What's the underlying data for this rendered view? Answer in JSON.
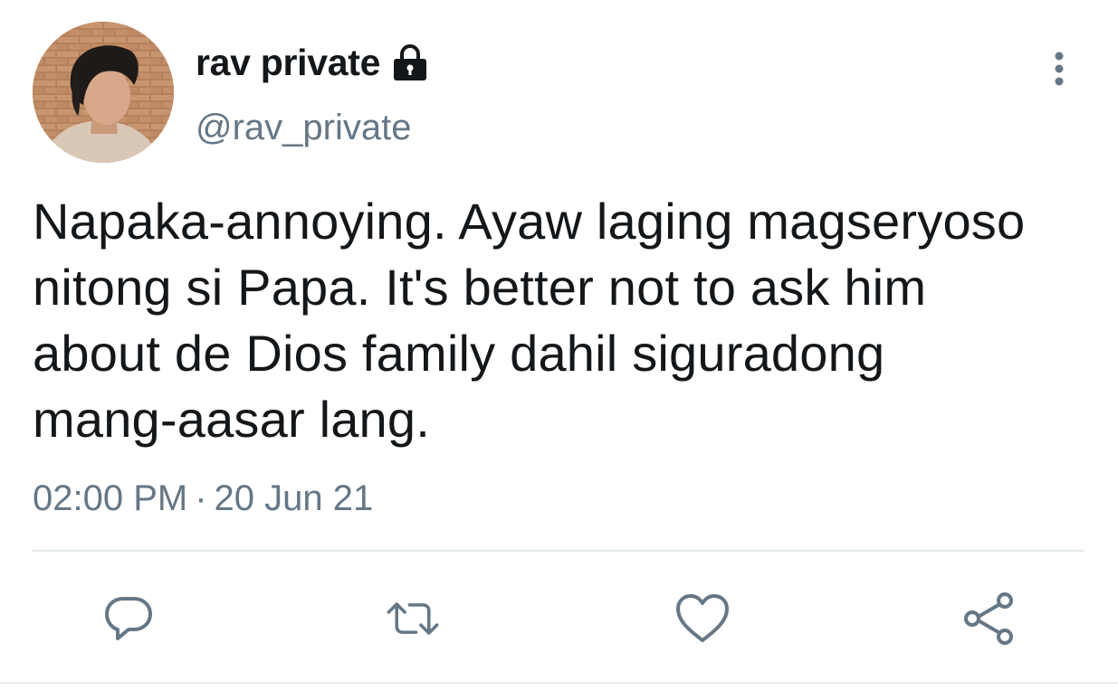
{
  "tweet": {
    "display_name": "rav private",
    "handle": "@rav_private",
    "body": "Napaka-annoying. Ayaw laging magseryoso\nnitong si Papa. It's better not to ask him\nabout de Dios family dahil siguradong\nmang-aasar lang.",
    "time": "02:00 PM",
    "separator": "·",
    "date": "20 Jun 21",
    "protected": true
  },
  "icons": {
    "lock": "lock-icon",
    "more": "more-vertical-icon",
    "reply": "reply-icon",
    "retweet": "retweet-icon",
    "like": "heart-icon",
    "share": "share-icon"
  },
  "colors": {
    "text_primary": "#14171a",
    "text_secondary": "#657786",
    "icon_gray": "#657786",
    "divider": "#e1e8ed"
  }
}
